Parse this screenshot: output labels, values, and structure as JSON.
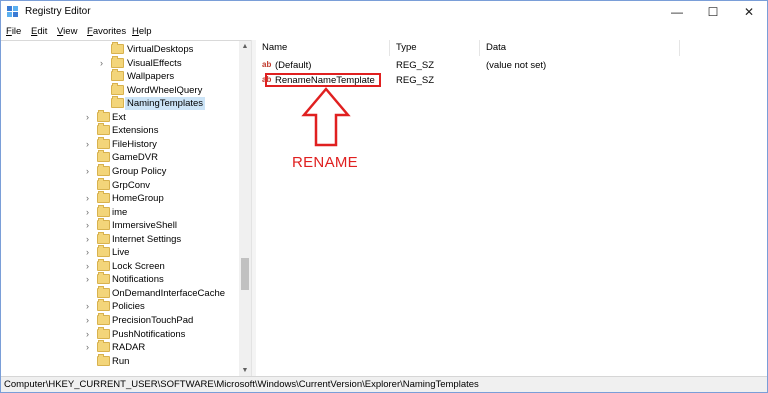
{
  "window": {
    "title": "Registry Editor",
    "controls": {
      "minimize": "—",
      "maximize": "☐",
      "close": "✕"
    }
  },
  "menu": [
    {
      "underline": "F",
      "rest": "ile"
    },
    {
      "underline": "E",
      "rest": "dit"
    },
    {
      "underline": "V",
      "rest": "iew"
    },
    {
      "underline": "F",
      "rest": "avorites"
    },
    {
      "underline": "H",
      "rest": "elp"
    }
  ],
  "tree": {
    "items": [
      {
        "label": "VirtualDesktops",
        "expandable": false
      },
      {
        "label": "VisualEffects",
        "expandable": true
      },
      {
        "label": "Wallpapers",
        "expandable": false
      },
      {
        "label": "WordWheelQuery",
        "expandable": false
      },
      {
        "label": "NamingTemplates",
        "expandable": false,
        "selected": true
      },
      {
        "label": "Ext",
        "expandable": true
      },
      {
        "label": "Extensions",
        "expandable": false
      },
      {
        "label": "FileHistory",
        "expandable": true
      },
      {
        "label": "GameDVR",
        "expandable": false
      },
      {
        "label": "Group Policy",
        "expandable": true
      },
      {
        "label": "GrpConv",
        "expandable": false
      },
      {
        "label": "HomeGroup",
        "expandable": true
      },
      {
        "label": "ime",
        "expandable": true
      },
      {
        "label": "ImmersiveShell",
        "expandable": true
      },
      {
        "label": "Internet Settings",
        "expandable": true
      },
      {
        "label": "Live",
        "expandable": true
      },
      {
        "label": "Lock Screen",
        "expandable": true
      },
      {
        "label": "Notifications",
        "expandable": true
      },
      {
        "label": "OnDemandInterfaceCache",
        "expandable": false
      },
      {
        "label": "Policies",
        "expandable": true
      },
      {
        "label": "PrecisionTouchPad",
        "expandable": true
      },
      {
        "label": "PushNotifications",
        "expandable": true
      },
      {
        "label": "RADAR",
        "expandable": true
      },
      {
        "label": "Run",
        "expandable": false
      }
    ]
  },
  "list": {
    "headers": {
      "name": "Name",
      "type": "Type",
      "data": "Data"
    },
    "rows": [
      {
        "name": "(Default)",
        "type": "REG_SZ",
        "data": "(value not set)"
      },
      {
        "name": "RenameNameTemplate",
        "type": "REG_SZ",
        "data": ""
      }
    ]
  },
  "annotation": {
    "text": "RENAME",
    "color": "#e02020"
  },
  "status": {
    "path": "Computer\\HKEY_CURRENT_USER\\SOFTWARE\\Microsoft\\Windows\\CurrentVersion\\Explorer\\NamingTemplates"
  },
  "colors": {
    "accent_red": "#e02020",
    "selection": "#cce4f7",
    "folder": "#f3d57a"
  },
  "icons": {
    "app": "registry-editor-icon",
    "value": "string-value-icon",
    "folder": "folder-icon",
    "expander": "chevron-right-icon"
  }
}
